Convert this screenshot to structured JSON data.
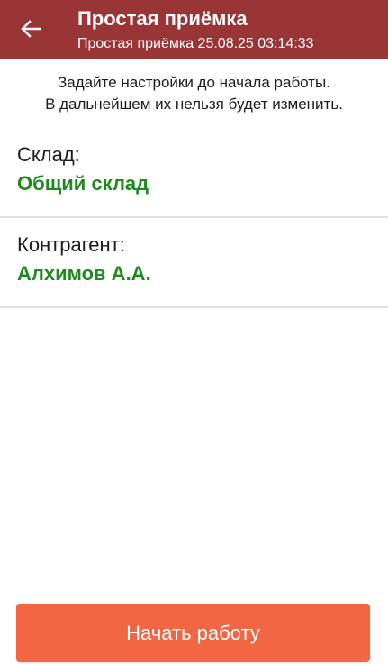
{
  "header": {
    "back_icon": "arrow-left-icon",
    "title": "Простая приёмка",
    "subtitle": "Простая приёмка 25.08.25 03:14:33",
    "background_color": "#9a3537"
  },
  "notice": {
    "line1": "Задайте настройки до начала работы.",
    "line2": "В дальнейшем их нельзя будет изменить."
  },
  "fields": [
    {
      "label": "Склад:",
      "value": "Общий склад"
    },
    {
      "label": "Контрагент:",
      "value": "Алхимов А.А."
    }
  ],
  "colors": {
    "value_green": "#1e8a1e",
    "button_orange": "#f26644"
  },
  "actions": {
    "start_label": "Начать работу"
  }
}
